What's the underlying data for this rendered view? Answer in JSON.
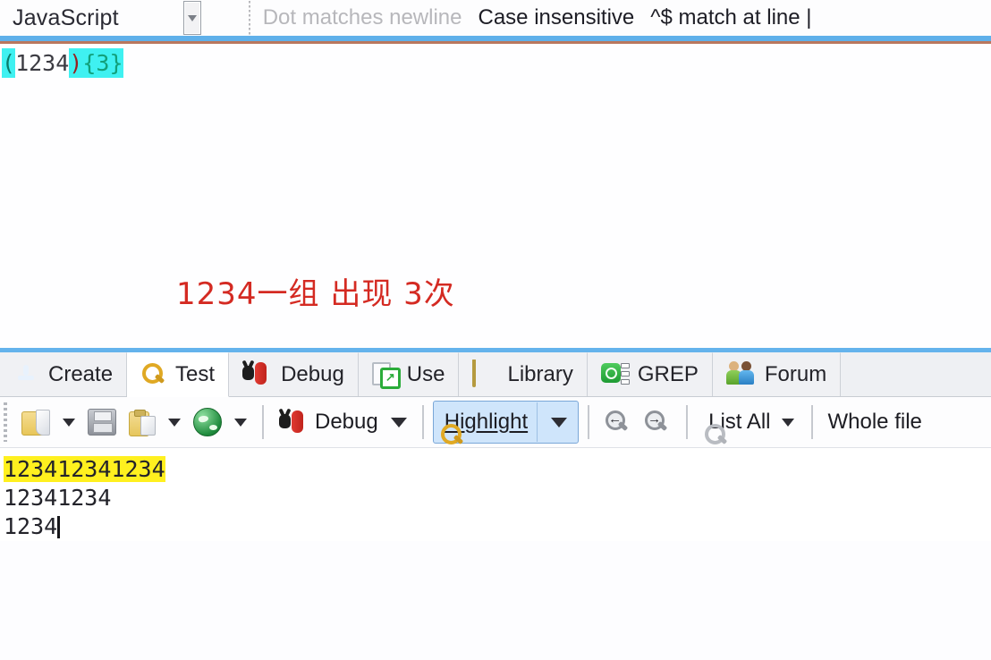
{
  "app": {
    "name": "RegexBuddy",
    "accent_blue": "#5fb0ea",
    "highlight_cyan": "#3ff1f1",
    "match_yellow": "#fff01f",
    "note_red": "#d42a22"
  },
  "topbar": {
    "language": "JavaScript",
    "language_dropdown_icon": "chevron-down-icon",
    "options": [
      {
        "label": "Dot matches newline",
        "enabled": false,
        "accesskey": "D"
      },
      {
        "label": "Case insensitive",
        "enabled": true,
        "accesskey": ""
      },
      {
        "label": "^$ match at line |",
        "enabled": true,
        "accesskey": ""
      }
    ]
  },
  "regex_editor": {
    "pattern": "(1234){3}",
    "tokens": [
      {
        "text": "(",
        "color": "#0a7b6b",
        "highlighted": true
      },
      {
        "text": "1234",
        "color": "#3b3b42",
        "highlighted": false
      },
      {
        "text": ")",
        "color": "#9a2020",
        "highlighted": true
      },
      {
        "text": "{3}",
        "color": "#12a07a",
        "highlighted": true
      }
    ],
    "annotation": "1234一组 出现 3次"
  },
  "tabs": [
    {
      "label": "Create",
      "icon": "create-icon",
      "active": false
    },
    {
      "label": "Test",
      "icon": "magnifier-icon",
      "active": true
    },
    {
      "label": "Debug",
      "icon": "bug-icon",
      "active": false
    },
    {
      "label": "Use",
      "icon": "use-icon",
      "active": false
    },
    {
      "label": "Library",
      "icon": "library-icon",
      "active": false
    },
    {
      "label": "GREP",
      "icon": "grep-icon",
      "active": false
    },
    {
      "label": "Forum",
      "icon": "forum-icon",
      "active": false
    }
  ],
  "toolbar": {
    "open_label": "",
    "open_icon": "folder-open-icon",
    "save_icon": "save-floppy-icon",
    "paste_icon": "clipboard-paste-icon",
    "browser_icon": "globe-icon",
    "debug_label": "Debug",
    "debug_accesskey": "g",
    "highlight_label": "Highlight",
    "highlight_accesskey": "H",
    "highlight_selected": true,
    "find_prev_icon": "search-previous-icon",
    "find_next_icon": "search-next-icon",
    "list_all_label": "List All",
    "list_all_accesskey": "L",
    "list_all_icon": "magnifier-icon",
    "scope_label": "Whole file"
  },
  "subject": {
    "lines": [
      {
        "text": "123412341234",
        "matched": true
      },
      {
        "text": "12341234",
        "matched": false
      },
      {
        "text": "1234",
        "matched": false,
        "cursor": true
      }
    ]
  }
}
